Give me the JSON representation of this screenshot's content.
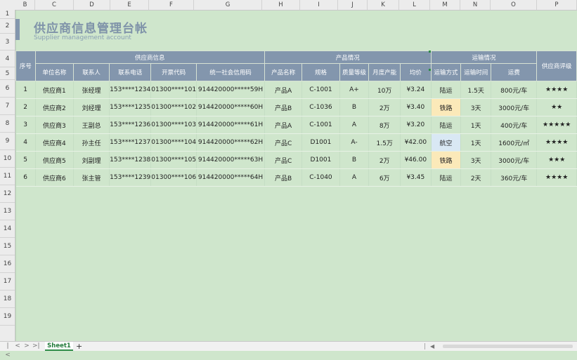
{
  "columns": [
    "B",
    "C",
    "D",
    "E",
    "F",
    "G",
    "H",
    "I",
    "J",
    "K",
    "L",
    "M",
    "N",
    "O",
    "P"
  ],
  "rows": [
    "1",
    "2",
    "3",
    "4",
    "5",
    "6",
    "7",
    "8",
    "9",
    "10",
    "11",
    "12",
    "13",
    "14",
    "15",
    "16",
    "17",
    "18",
    "19"
  ],
  "title": "供应商信息管理台帐",
  "subtitle": "Supplier management account",
  "header": {
    "seq": "序号",
    "group_supplier": "供应商信息",
    "group_product": "产品情况",
    "group_transport": "运输情况",
    "rating": "供应商评级",
    "sub": [
      "单位名称",
      "联系人",
      "联系电话",
      "开票代码",
      "统一社会信用码",
      "产品名称",
      "规格",
      "质量等级",
      "月度产能",
      "均价",
      "运输方式",
      "运输时间",
      "运费"
    ]
  },
  "records": [
    [
      "1",
      "供应商1",
      "张经理",
      "153****1234",
      "01300****101",
      "914420000*****59H",
      "产品A",
      "C-1001",
      "A+",
      "10万",
      "¥3.24",
      "陆运",
      "1.5天",
      "800元/车",
      "★★★★"
    ],
    [
      "2",
      "供应商2",
      "刘经理",
      "153****1235",
      "01300****102",
      "914420000*****60H",
      "产品B",
      "C-1036",
      "B",
      "2万",
      "¥3.40",
      "铁路",
      "3天",
      "3000元/车",
      "★★"
    ],
    [
      "3",
      "供应商3",
      "王副总",
      "153****1236",
      "01300****103",
      "914420000*****61H",
      "产品A",
      "C-1001",
      "A",
      "8万",
      "¥3.20",
      "陆运",
      "1天",
      "400元/车",
      "★★★★★"
    ],
    [
      "4",
      "供应商4",
      "孙主任",
      "153****1237",
      "01300****104",
      "914420000*****62H",
      "产品C",
      "D1001",
      "A-",
      "1.5万",
      "¥42.00",
      "航空",
      "1天",
      "1600元/㎡",
      "★★★★"
    ],
    [
      "5",
      "供应商5",
      "刘副理",
      "153****1238",
      "01300****105",
      "914420000*****63H",
      "产品C",
      "D1001",
      "B",
      "2万",
      "¥46.00",
      "铁路",
      "3天",
      "3000元/车",
      "★★★"
    ],
    [
      "6",
      "供应商6",
      "张主管",
      "153****1239",
      "01300****106",
      "914420000*****64H",
      "产品B",
      "C-1040",
      "A",
      "6万",
      "¥3.45",
      "陆运",
      "2天",
      "360元/车",
      "★★★★"
    ]
  ],
  "sheet_tab": "Sheet1",
  "add_tab": "+",
  "nav": [
    "|<",
    "<",
    ">",
    ">|"
  ],
  "colors": {
    "header_bg": "#8396ad",
    "sheet_bg": "#cfe6cc",
    "highlight_rail": "#fbe9b9",
    "highlight_air": "#d9e8f4"
  }
}
